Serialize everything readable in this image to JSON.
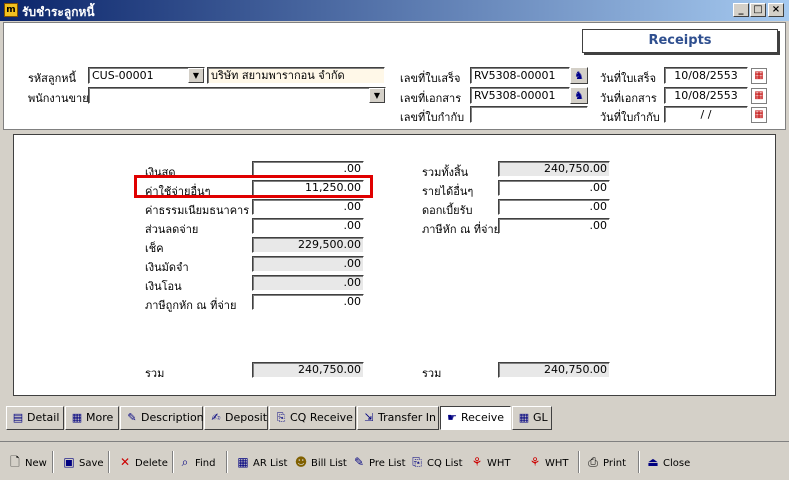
{
  "window": {
    "title": "รับชำระลูกหนี้",
    "minimize": "_",
    "maximize": "□",
    "close": "×"
  },
  "header": {
    "receipts_label": "Receipts",
    "customer_code_label": "รหัสลูกหนี้",
    "customer_code": "CUS-00001",
    "customer_name": "บริษัท สยามพารากอน จำกัด",
    "salesperson_label": "พนักงานขาย",
    "salesperson": "",
    "receipt_no_label": "เลขที่ใบเสร็จ",
    "receipt_no": "RV5308-00001",
    "doc_no_label": "เลขที่เอกสาร",
    "doc_no": "RV5308-00001",
    "tax_invoice_label": "เลขที่ใบกำกับ",
    "tax_invoice": "",
    "receipt_date_label": "วันที่ใบเสร็จ",
    "receipt_date": "10/08/2553",
    "doc_date_label": "วันที่เอกสาร",
    "doc_date": "10/08/2553",
    "tax_invoice_date_label": "วันที่ใบกำกับ",
    "tax_invoice_date": " /  /"
  },
  "payment": {
    "left": [
      {
        "label": "เงินสด",
        "value": ".00"
      },
      {
        "label": "ค่าใช้จ่ายอื่นๆ",
        "value": "11,250.00"
      },
      {
        "label": "ค่าธรรมเนียมธนาคาร",
        "value": ".00"
      },
      {
        "label": "ส่วนลดจ่าย",
        "value": ".00"
      },
      {
        "label": "เช็ค",
        "value": "229,500.00"
      },
      {
        "label": "เงินมัดจำ",
        "value": ".00"
      },
      {
        "label": "เงินโอน",
        "value": ".00"
      },
      {
        "label": "ภาษีถูกหัก ณ ที่จ่าย",
        "value": ".00"
      }
    ],
    "right": [
      {
        "label": "รวมทั้งสิ้น",
        "value": "240,750.00"
      },
      {
        "label": "รายได้อื่นๆ",
        "value": ".00"
      },
      {
        "label": "ดอกเบี้ยรับ",
        "value": ".00"
      },
      {
        "label": "ภาษีหัก ณ ที่จ่าย",
        "value": ".00"
      }
    ],
    "left_total_label": "รวม",
    "left_total": "240,750.00",
    "right_total_label": "รวม",
    "right_total": "240,750.00"
  },
  "tabs": [
    {
      "label": "Detail",
      "icon": "▤"
    },
    {
      "label": "More",
      "icon": "▦"
    },
    {
      "label": "Description",
      "icon": "✎"
    },
    {
      "label": "Deposit",
      "icon": "✍"
    },
    {
      "label": "CQ Receive",
      "icon": "⎘"
    },
    {
      "label": "Transfer In",
      "icon": "⇲"
    },
    {
      "label": "Receive",
      "icon": "☛"
    },
    {
      "label": "GL",
      "icon": "▦"
    }
  ],
  "toolbar": [
    {
      "label": "New",
      "icon": "🗋",
      "color": "#000000"
    },
    {
      "label": "Save",
      "icon": "▣",
      "color": "#000080"
    },
    {
      "label": "Delete",
      "icon": "✕",
      "color": "#cc0000"
    },
    {
      "label": "Find",
      "icon": "⌕",
      "color": "#000080"
    },
    {
      "label": "AR List",
      "icon": "▦",
      "color": "#000080"
    },
    {
      "label": "Bill List",
      "icon": "☻",
      "color": "#806000"
    },
    {
      "label": "Pre List",
      "icon": "✎",
      "color": "#000080"
    },
    {
      "label": "CQ List",
      "icon": "⎘",
      "color": "#000080"
    },
    {
      "label": "WHT",
      "icon": "⚘",
      "color": "#cc0000"
    },
    {
      "label": "WHT",
      "icon": "⚘",
      "color": "#cc0000"
    },
    {
      "label": "Print",
      "icon": "⎙",
      "color": "#000000"
    },
    {
      "label": "Close",
      "icon": "⏏",
      "color": "#000080"
    }
  ]
}
